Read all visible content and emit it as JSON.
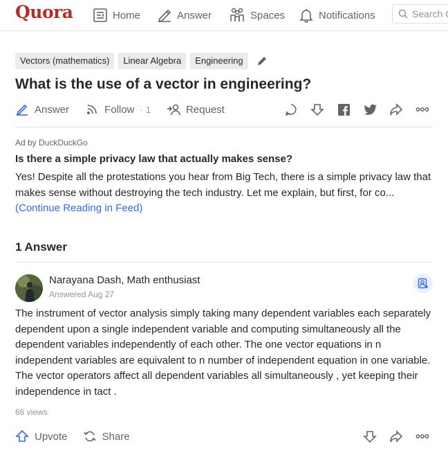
{
  "header": {
    "logo": "Quora",
    "nav": [
      {
        "label": "Home",
        "icon": "home-icon"
      },
      {
        "label": "Answer",
        "icon": "answer-icon"
      },
      {
        "label": "Spaces",
        "icon": "spaces-icon"
      },
      {
        "label": "Notifications",
        "icon": "bell-icon"
      }
    ],
    "search_placeholder": "Search Q"
  },
  "question": {
    "tags": [
      "Vectors (mathematics)",
      "Linear Algebra",
      "Engineering"
    ],
    "title": "What is the use of a vector in engineering?",
    "actions": {
      "answer": "Answer",
      "follow": "Follow",
      "follow_sep": "·",
      "follow_count": "1",
      "request": "Request"
    }
  },
  "ad": {
    "label": "Ad by DuckDuckGo",
    "title": "Is there a simple privacy law that actually makes sense?",
    "body": "Yes! Despite all the protestations you hear from Big Tech, there is a simple privacy law that makes sense without destroying the tech industry. Let me explain, but first, for co... ",
    "link": "(Continue Reading in Feed)"
  },
  "answers": {
    "count_label": "1 Answer",
    "items": [
      {
        "author": "Narayana Dash, Math enthusiast",
        "date": "Answered Aug 27",
        "body": "The instrument of vector analysis simply taking many dependent variables each separately dependent upon a single independent variable and computing simultaneously all the dependent variables independently of each other. The one vector equations in n independent variables are equivalent to n number of independent equation in one variable. The vector operators affect all dependent variables all simultaneously , yet keeping their independence in tact .",
        "views": "66 views",
        "upvote": "Upvote",
        "share": "Share"
      }
    ]
  },
  "colors": {
    "brand": "#b92b27",
    "link": "#2e69ff",
    "text": "#282829",
    "muted": "#636466",
    "divider": "#dee0e1"
  }
}
